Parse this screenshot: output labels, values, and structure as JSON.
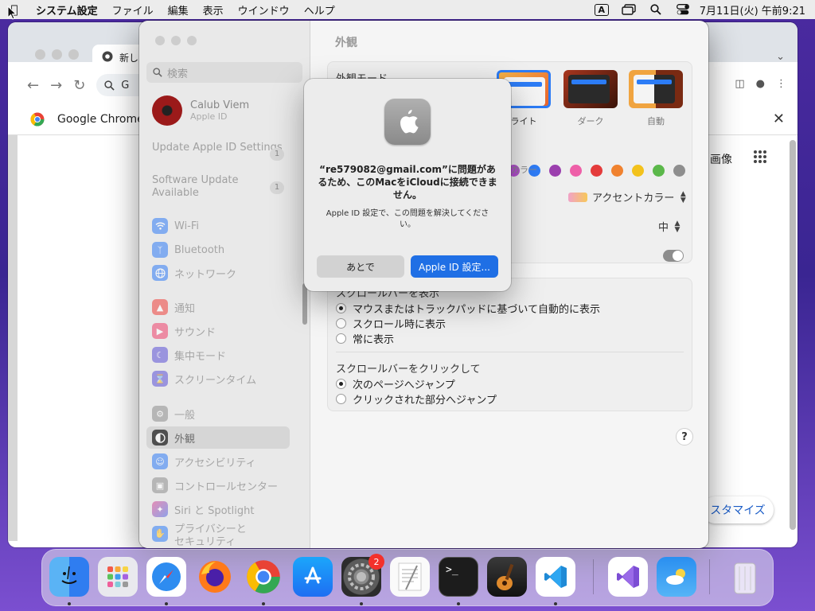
{
  "menubar": {
    "app_name": "システム設定",
    "items": [
      "ファイル",
      "編集",
      "表示",
      "ウインドウ",
      "ヘルプ"
    ],
    "input_indicator": "A",
    "clock": "7月11日(火) 午前9:21"
  },
  "chrome": {
    "tab_title": "新し",
    "omnibox_text": "G",
    "infobar_text": "Google Chrome",
    "images_link": "画像",
    "customize_label": "スタマイズ"
  },
  "settings": {
    "search_placeholder": "検索",
    "user": {
      "name": "Calub Viem",
      "sub": "Apple ID"
    },
    "notices": [
      {
        "label": "Update Apple ID Settings",
        "count": "1"
      },
      {
        "label": "Software Update Available",
        "count": "1"
      }
    ],
    "sidebar": [
      {
        "label": "Wi-Fi",
        "icon": "wifi-icon",
        "color": "#2f7cf6"
      },
      {
        "label": "Bluetooth",
        "icon": "bluetooth-icon",
        "color": "#2f7cf6"
      },
      {
        "label": "ネットワーク",
        "icon": "globe-icon",
        "color": "#2f7cf6"
      },
      {
        "label": "通知",
        "icon": "bell-icon",
        "color": "#ef3f3a"
      },
      {
        "label": "サウンド",
        "icon": "speaker-icon",
        "color": "#ef3f6a"
      },
      {
        "label": "集中モード",
        "icon": "moon-icon",
        "color": "#5b4fd6"
      },
      {
        "label": "スクリーンタイム",
        "icon": "hourglass-icon",
        "color": "#5b4fd6"
      },
      {
        "label": "一般",
        "icon": "gear-icon",
        "color": "#8e8e8e"
      },
      {
        "label": "外観",
        "icon": "appearance-icon",
        "color": "#222222"
      },
      {
        "label": "アクセシビリティ",
        "icon": "accessibility-icon",
        "color": "#2f7cf6"
      },
      {
        "label": "コントロールセンター",
        "icon": "control-center-icon",
        "color": "#8e8e8e"
      },
      {
        "label": "Siri と Spotlight",
        "icon": "siri-icon",
        "color": "#b04ad8"
      },
      {
        "label": "プライバシーと\nセキュリティ",
        "icon": "hand-icon",
        "color": "#2f7cf6"
      }
    ],
    "content_title": "外観",
    "appearance_mode_label": "外観モード",
    "modes": [
      {
        "label": "ライト",
        "selected": true
      },
      {
        "label": "ダーク",
        "selected": false
      },
      {
        "label": "自動",
        "selected": false
      }
    ],
    "accent_colors": [
      "#b44fd0",
      "#2e7cf6",
      "#9b3fae",
      "#ee5fa8",
      "#e43b3b",
      "#f0822f",
      "#f3c21c",
      "#5bb84a",
      "#8e8e8e"
    ],
    "accent_label": "カラー",
    "highlight_popup": "アクセントカラー",
    "sidebar_size_popup": "中",
    "scrollbar_show_label": "スクロールバーを表示",
    "scrollbar_show_options": [
      {
        "label": "マウスまたはトラックパッドに基づいて自動的に表示",
        "selected": true
      },
      {
        "label": "スクロール時に表示",
        "selected": false
      },
      {
        "label": "常に表示",
        "selected": false
      }
    ],
    "scrollbar_click_label": "スクロールバーをクリックして",
    "scrollbar_click_options": [
      {
        "label": "次のページへジャンプ",
        "selected": true
      },
      {
        "label": "クリックされた部分へジャンプ",
        "selected": false
      }
    ],
    "help_label": "?"
  },
  "alert": {
    "message": "“re579082@gmail.com”に問題があるため、このMacをiCloudに接続できません。",
    "info": "Apple ID 設定で、この問題を解決してください。",
    "later_button": "あとで",
    "settings_button": "Apple ID 設定..."
  },
  "dock": {
    "items": [
      "finder-icon",
      "launchpad-icon",
      "safari-icon",
      "firefox-icon",
      "chrome-icon",
      "app-store-icon",
      "system-settings-icon",
      "textedit-icon",
      "terminal-icon",
      "garageband-icon",
      "vscode-icon",
      "visual-studio-icon",
      "weather-icon",
      "trash-icon"
    ],
    "settings_badge": "2"
  }
}
